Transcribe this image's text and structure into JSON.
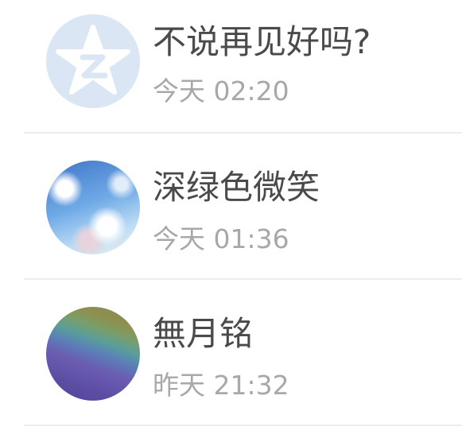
{
  "conversations": [
    {
      "name": "不说再见好吗?",
      "time": "今天 02:20",
      "avatar": "default-qq-star-avatar"
    },
    {
      "name": "深绿色微笑",
      "time": "今天 01:36",
      "avatar": "sky-anime-avatar"
    },
    {
      "name": "無月铭",
      "time": "昨天 21:32",
      "avatar": "rainbow-gradient-avatar"
    }
  ],
  "colors": {
    "name_text": "#4a4a4a",
    "time_text": "#a8a8a8",
    "divider": "#ececec",
    "default_avatar_bg": "#dbe6f5"
  }
}
